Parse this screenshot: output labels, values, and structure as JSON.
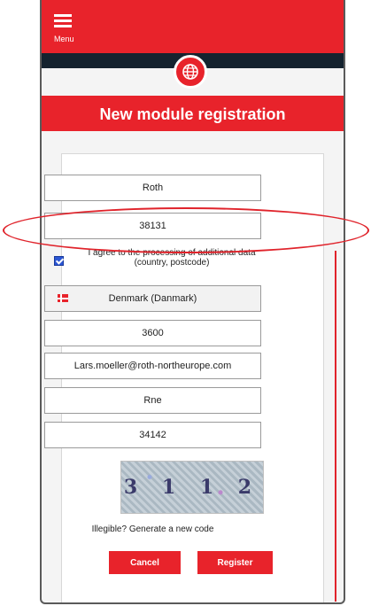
{
  "header": {
    "menu_label": "Menu",
    "globe_icon": "globe-icon",
    "title": "New module registration"
  },
  "form": {
    "name_value": "Roth",
    "postcode_value": "38131",
    "consent_checked": true,
    "consent_text": "I agree to the processing of additional data (country, postcode)",
    "country_value": "Denmark (Danmark)",
    "country_flag": "denmark-flag-icon",
    "zip_value": "3600",
    "email_value": "Lars.moeller@roth-northeurope.com",
    "city_value": "Rne",
    "code_value": "34142",
    "captcha_text": "3 1 1 2",
    "illegible_text": "Illegible? Generate a new code",
    "cancel_label": "Cancel",
    "register_label": "Register"
  },
  "colors": {
    "brand_red": "#e8232b",
    "dark_band": "#15232f",
    "annotation_red": "#e0232b"
  }
}
